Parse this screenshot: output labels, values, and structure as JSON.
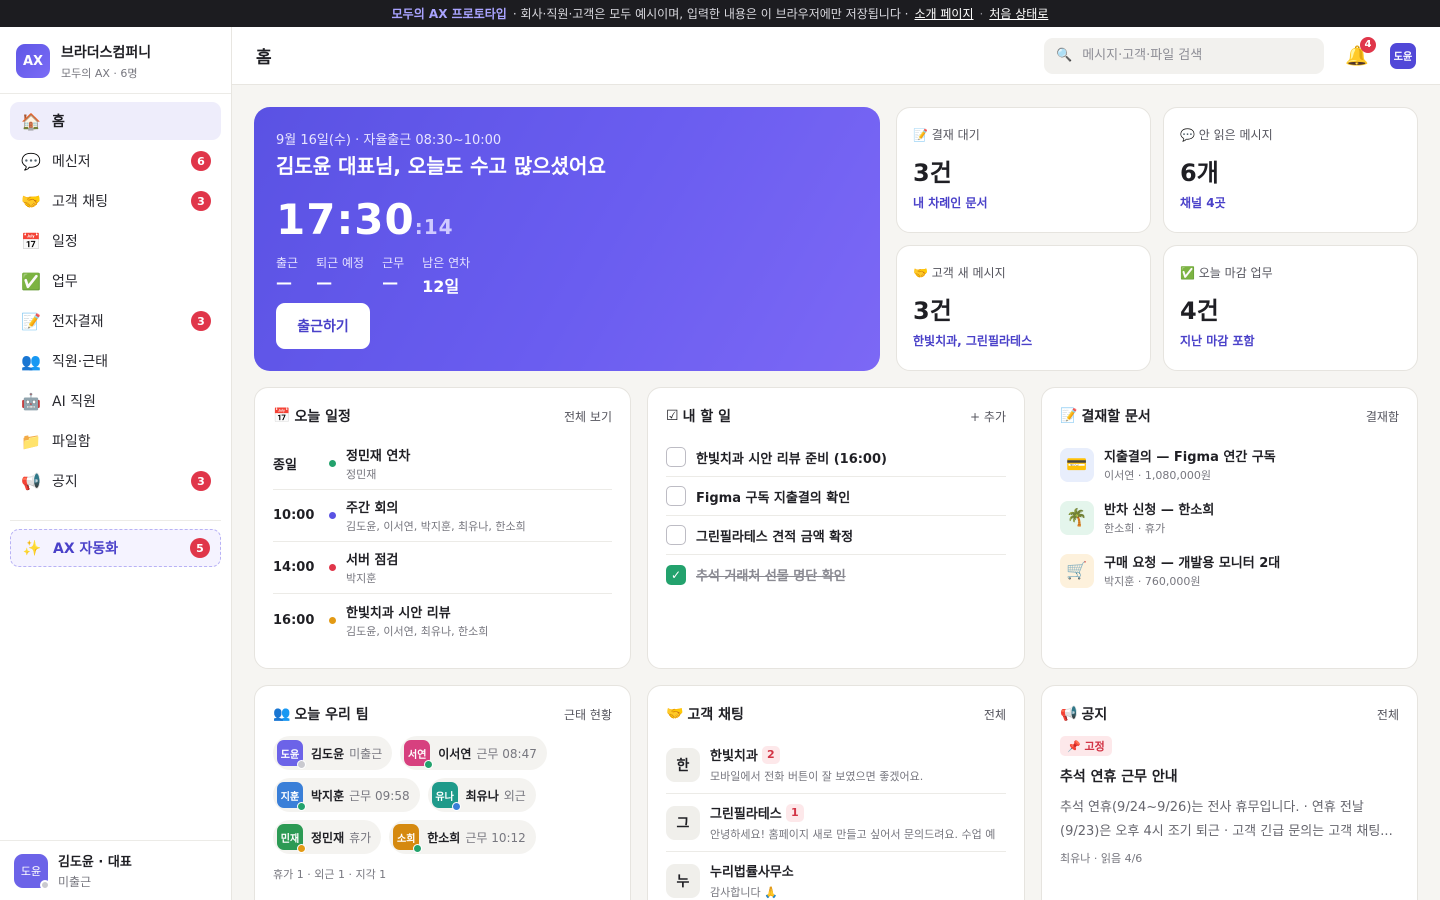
{
  "banner": {
    "brand": "모두의 AX 프로토타입",
    "text": "· 회사·직원·고객은 모두 예시이며, 입력한 내용은 이 브라우저에만 저장됩니다 ·",
    "intro_link": "소개 페이지",
    "dot": "·",
    "reset_link": "처음 상태로"
  },
  "workspace": {
    "logo": "AX",
    "name": "브라더스컴퍼니",
    "sub": "모두의 AX · 6명"
  },
  "sidebar": {
    "items": [
      {
        "icon": "🏠",
        "label": "홈",
        "badge": ""
      },
      {
        "icon": "💬",
        "label": "메신저",
        "badge": "6"
      },
      {
        "icon": "🤝",
        "label": "고객 채팅",
        "badge": "3"
      },
      {
        "icon": "📅",
        "label": "일정",
        "badge": ""
      },
      {
        "icon": "✅",
        "label": "업무",
        "badge": ""
      },
      {
        "icon": "📝",
        "label": "전자결재",
        "badge": "3"
      },
      {
        "icon": "👥",
        "label": "직원·근태",
        "badge": ""
      },
      {
        "icon": "🤖",
        "label": "AI 직원",
        "badge": ""
      },
      {
        "icon": "📁",
        "label": "파일함",
        "badge": ""
      },
      {
        "icon": "📢",
        "label": "공지",
        "badge": "3"
      }
    ],
    "ax": {
      "icon": "✨",
      "label": "AX 자동화",
      "badge": "5"
    },
    "me": {
      "avatar": "도윤",
      "name": "김도윤 · 대표",
      "status": "미출근"
    }
  },
  "header": {
    "title": "홈",
    "search_placeholder": "메시지·고객·파일 검색",
    "bell_count": "4",
    "avatar": "도윤"
  },
  "hero": {
    "date": "9월 16일(수) · 자율출근 08:30~10:00",
    "greeting": "김도윤 대표님, 오늘도 수고 많으셨어요",
    "time": "17:30",
    "seconds": ":14",
    "stats": [
      {
        "label": "출근",
        "value": "—"
      },
      {
        "label": "퇴근 예정",
        "value": "—"
      },
      {
        "label": "근무",
        "value": "—"
      },
      {
        "label": "남은 연차",
        "value": "12일"
      }
    ],
    "checkin_label": "출근하기"
  },
  "stat_cards": [
    {
      "title": "📝 결재 대기",
      "value": "3건",
      "sub": "내 차례인 문서"
    },
    {
      "title": "💬 안 읽은 메시지",
      "value": "6개",
      "sub": "채널 4곳"
    },
    {
      "title": "🤝 고객 새 메시지",
      "value": "3건",
      "sub": "한빛치과, 그린필라테스"
    },
    {
      "title": "✅ 오늘 마감 업무",
      "value": "4건",
      "sub": "지난 마감 포함"
    }
  ],
  "schedule": {
    "icon": "📅",
    "title": "오늘 일정",
    "link": "전체 보기",
    "rows": [
      {
        "time": "종일",
        "color": "#23a26d",
        "title": "정민재 연차",
        "sub": "정민재"
      },
      {
        "time": "10:00",
        "color": "#5a52e3",
        "title": "주간 회의",
        "sub": "김도윤, 이서연, 박지훈, 최유나, 한소희"
      },
      {
        "time": "14:00",
        "color": "#e0364a",
        "title": "서버 점검",
        "sub": "박지훈"
      },
      {
        "time": "16:00",
        "color": "#e39a14",
        "title": "한빛치과 시안 리뷰",
        "sub": "김도윤, 이서연, 최유나, 한소희"
      }
    ]
  },
  "todo": {
    "icon": "☑",
    "title": "내 할 일",
    "link": "+ 추가",
    "rows": [
      {
        "text": "한빛치과 시안 리뷰 준비 (16:00)",
        "done": false
      },
      {
        "text": "Figma 구독 지출결의 확인",
        "done": false
      },
      {
        "text": "그린필라테스 견적 금액 확정",
        "done": false
      },
      {
        "text": "추석 거래처 선물 명단 확인",
        "done": true
      }
    ]
  },
  "approvals": {
    "icon": "📝",
    "title": "결재할 문서",
    "link": "결재함",
    "rows": [
      {
        "icon": "💳",
        "bg": "#e8eefc",
        "title": "지출결의 — Figma 연간 구독",
        "sub": "이서연 · 1,080,000원"
      },
      {
        "icon": "🌴",
        "bg": "#e4f5ec",
        "title": "반차 신청 — 한소희",
        "sub": "한소희 · 휴가"
      },
      {
        "icon": "🛒",
        "bg": "#fdf1dc",
        "title": "구매 요청 — 개발용 모니터 2대",
        "sub": "박지훈 · 760,000원"
      }
    ]
  },
  "team": {
    "icon": "👥",
    "title": "오늘 우리 팀",
    "link": "근태 현황",
    "members": [
      {
        "av": "도윤",
        "color": "#6c63e8",
        "dot": "#c9c9cf",
        "name": "김도윤",
        "status": "미출근"
      },
      {
        "av": "서연",
        "color": "#d7407f",
        "dot": "#23a26d",
        "name": "이서연",
        "status": "근무 08:47"
      },
      {
        "av": "지훈",
        "color": "#3a7fd8",
        "dot": "#23a26d",
        "name": "박지훈",
        "status": "근무 09:58"
      },
      {
        "av": "유나",
        "color": "#1f9a8a",
        "dot": "#3a7fd8",
        "name": "최유나",
        "status": "외근"
      },
      {
        "av": "민재",
        "color": "#2c9a54",
        "dot": "#e39a14",
        "name": "정민재",
        "status": "휴가"
      },
      {
        "av": "소희",
        "color": "#d5890f",
        "dot": "#23a26d",
        "name": "한소희",
        "status": "근무 10:12"
      }
    ],
    "summary": "휴가 1 · 외근 1 · 지각 1"
  },
  "chats": {
    "icon": "🤝",
    "title": "고객 채팅",
    "link": "전체",
    "rows": [
      {
        "av": "한",
        "name": "한빛치과",
        "count": "2",
        "msg": "모바일에서 전화 버튼이 잘 보였으면 좋겠어요."
      },
      {
        "av": "그",
        "name": "그린필라테스",
        "count": "1",
        "msg": "안녕하세요! 홈페이지 새로 만들고 싶어서 문의드려요. 수업 예"
      },
      {
        "av": "누",
        "name": "누리법률사무소",
        "count": "",
        "msg": "감사합니다 🙏"
      }
    ]
  },
  "notice": {
    "icon": "📢",
    "title": "공지",
    "link": "전체",
    "pin": "📌 고정",
    "headline": "추석 연휴 근무 안내",
    "body": "추석 연휴(9/24~9/26)는 전사 휴무입니다. · 연휴 전날 (9/23)은 오후 4시 조기 퇴근 · 고객 긴급 문의는 고객 채팅...",
    "meta": "최유나 · 읽음 4/6"
  }
}
